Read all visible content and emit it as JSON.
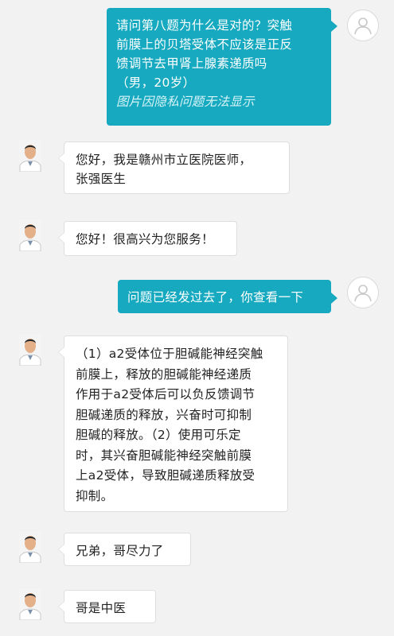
{
  "messages": [
    {
      "sender": "user",
      "lines": [
        "请问第八题为什么是对的？突触",
        "前膜上的贝塔受体不应该是正反",
        "馈调节去甲肾上腺素递质吗",
        "（男，20岁）"
      ],
      "note": "图片因隐私问题无法显示"
    },
    {
      "sender": "doctor",
      "lines": [
        "您好，我是赣州市立医院医师，",
        "张强医生"
      ]
    },
    {
      "sender": "doctor",
      "lines": [
        "您好！很高兴为您服务！"
      ]
    },
    {
      "sender": "user",
      "lines": [
        "问题已经发过去了，你查看一下"
      ]
    },
    {
      "sender": "doctor",
      "lines": [
        "（1）a2受体位于胆碱能神经突触",
        "前膜上，释放的胆碱能神经递质",
        "作用于a2受体后可以负反馈调节",
        "胆碱递质的释放，兴奋时可抑制",
        "胆碱的释放。（2）使用可乐定",
        "时，其兴奋胆碱能神经突触前膜",
        "上a2受体，导致胆碱递质释放受",
        "抑制。"
      ]
    },
    {
      "sender": "doctor",
      "lines": [
        "兄弟，哥尽力了"
      ]
    },
    {
      "sender": "doctor",
      "lines": [
        "哥是中医"
      ]
    }
  ],
  "colors": {
    "user_bubble": "#16a9c0",
    "doctor_bubble": "#ffffff",
    "background": "#f2f2f2"
  },
  "icons": {
    "user_avatar": "user-avatar-icon",
    "doctor_avatar": "doctor-avatar-photo"
  }
}
